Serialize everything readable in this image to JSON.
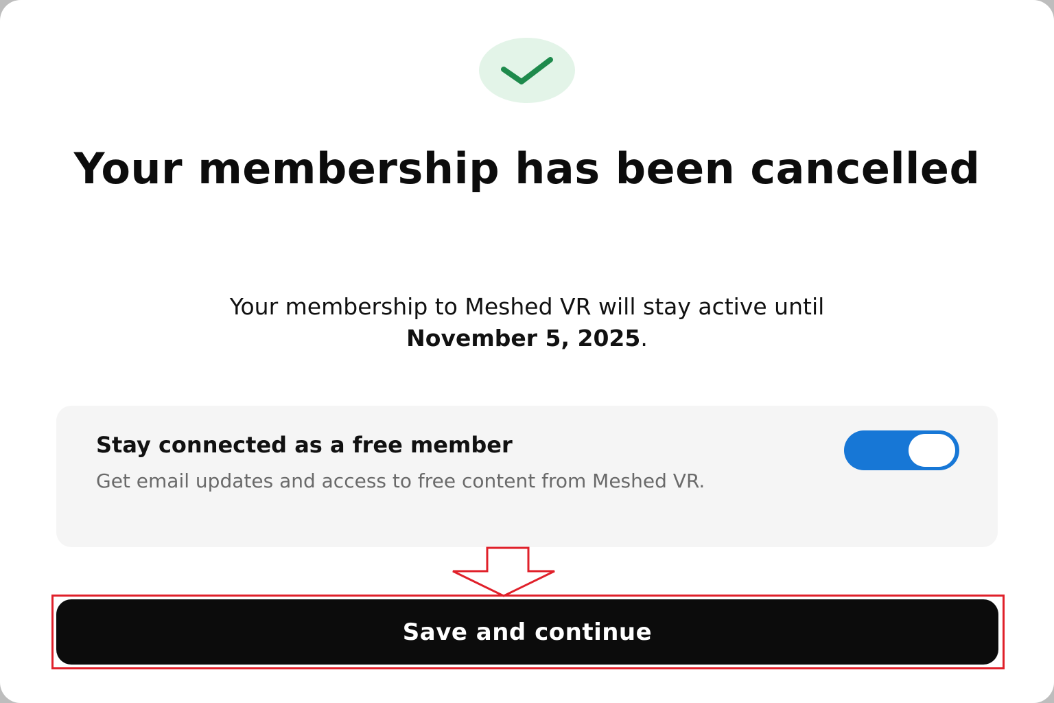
{
  "dialog": {
    "title": "Your membership has been cancelled",
    "message_prefix": "Your membership to Meshed VR will stay active until ",
    "end_date": "November 5, 2025",
    "message_suffix": "."
  },
  "free_member": {
    "title": "Stay connected as a free member",
    "description": "Get email updates and access to free content from Meshed VR.",
    "toggle_on": true
  },
  "actions": {
    "save_label": "Save and continue"
  },
  "icons": {
    "success": "check-icon",
    "annotation": "down-arrow-icon"
  },
  "colors": {
    "success_green": "#1e8a4c",
    "success_bg": "#e3f4e8",
    "toggle_blue": "#1777d6",
    "button_black": "#0c0c0c",
    "highlight_red": "#e0202a"
  }
}
